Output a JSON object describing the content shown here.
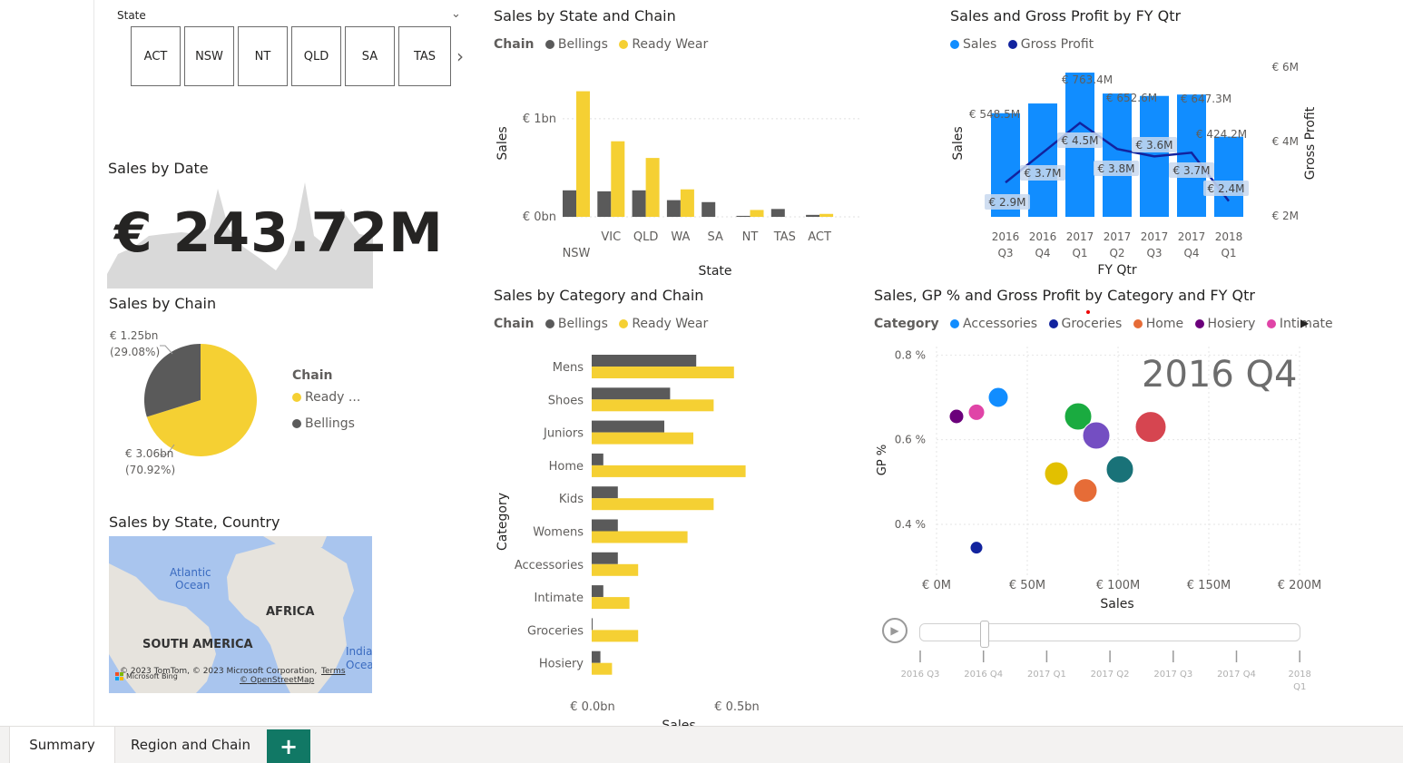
{
  "colors": {
    "bellings": "#5a5a5a",
    "ready_wear": "#f5d033",
    "sales_blue": "#118dff",
    "gp_navy": "#12239e",
    "page_bg": "#ffffff",
    "tab_accent": "#117865"
  },
  "slicer": {
    "label": "State",
    "tiles": [
      "ACT",
      "NSW",
      "NT",
      "QLD",
      "SA",
      "TAS"
    ]
  },
  "kpi": {
    "title": "Sales by Date",
    "value": "€ 243.72M"
  },
  "pie": {
    "title": "Sales by Chain",
    "legend_title": "Chain",
    "legend": [
      "Ready ...",
      "Bellings"
    ],
    "label_small_value": "€ 1.25bn",
    "label_small_pct": "(29.08%)",
    "label_large_value": "€ 3.06bn",
    "label_large_pct": "(70.92%)"
  },
  "map": {
    "title": "Sales by State, Country",
    "labels": {
      "atlantic": "Atlantic",
      "ocean": "Ocean",
      "africa": "AFRICA",
      "south_america": "SOUTH AMERICA",
      "india": "India",
      "ocea": "Ocea"
    },
    "attribution": "© 2023 TomTom, © 2023 Microsoft Corporation,",
    "terms": "Terms",
    "osm": "© OpenStreetMap",
    "bing": "Microsoft Bing"
  },
  "state_chart": {
    "title": "Sales by State and Chain",
    "legend_title": "Chain",
    "legend": [
      "Bellings",
      "Ready Wear"
    ],
    "ylabel": "Sales",
    "xlabel": "State",
    "ytick_top": "€ 1bn",
    "ytick_zero": "€ 0bn"
  },
  "category_chart": {
    "title": "Sales by Category and Chain",
    "legend_title": "Chain",
    "legend": [
      "Bellings",
      "Ready Wear"
    ],
    "ylabel": "Category",
    "xlabel": "Sales",
    "xtick_zero": "€ 0.0bn",
    "xtick_half": "€ 0.5bn"
  },
  "fy_chart": {
    "title": "Sales and Gross Profit by FY Qtr",
    "legend": [
      "Sales",
      "Gross Profit"
    ],
    "ylabel_left": "Sales",
    "ylabel_right": "Gross Profit",
    "xlabel": "FY Qtr",
    "right_ticks": [
      "€ 6M",
      "€ 4M",
      "€ 2M"
    ]
  },
  "scatter_chart": {
    "title": "Sales, GP % and Gross Profit by Category and FY Qtr",
    "legend_title": "Category",
    "legend": [
      "Accessories",
      "Groceries",
      "Home",
      "Hosiery",
      "Intimate"
    ],
    "play_value": "2016 Q4",
    "ylabel": "GP %",
    "xlabel": "Sales",
    "yticks": [
      "0.8 %",
      "0.6 %",
      "0.4 %"
    ],
    "xticks": [
      "€ 0M",
      "€ 50M",
      "€ 100M",
      "€ 150M",
      "€ 200M"
    ],
    "timeline": [
      "2016 Q3",
      "2016 Q4",
      "2017 Q1",
      "2017 Q2",
      "2017 Q3",
      "2017 Q4",
      "2018 Q1"
    ]
  },
  "tabs": {
    "summary": "Summary",
    "region": "Region and Chain",
    "add": "+"
  },
  "chart_data": [
    {
      "type": "bar",
      "title": "Sales by State and Chain",
      "xlabel": "State",
      "ylabel": "Sales",
      "categories": [
        "NSW",
        "VIC",
        "QLD",
        "WA",
        "SA",
        "NT",
        "TAS",
        "ACT"
      ],
      "series": [
        {
          "name": "Bellings",
          "values": [
            0.27,
            0.26,
            0.27,
            0.17,
            0.15,
            0.01,
            0.08,
            0.02
          ]
        },
        {
          "name": "Ready Wear",
          "values": [
            1.28,
            0.77,
            0.6,
            0.28,
            0.0,
            0.07,
            0.0,
            0.03
          ]
        }
      ],
      "ylim": [
        0,
        1.35
      ]
    },
    {
      "type": "bar",
      "orientation": "horizontal",
      "title": "Sales by Category and Chain",
      "xlabel": "Sales",
      "ylabel": "Category",
      "categories": [
        "Mens",
        "Shoes",
        "Juniors",
        "Home",
        "Kids",
        "Womens",
        "Accessories",
        "Intimate",
        "Groceries",
        "Hosiery"
      ],
      "series": [
        {
          "name": "Bellings",
          "values": [
            0.36,
            0.27,
            0.25,
            0.04,
            0.09,
            0.09,
            0.09,
            0.04,
            0.0,
            0.03
          ]
        },
        {
          "name": "Ready Wear",
          "values": [
            0.49,
            0.42,
            0.35,
            0.53,
            0.42,
            0.33,
            0.16,
            0.13,
            0.16,
            0.07
          ]
        }
      ],
      "xlim": [
        0,
        0.6
      ]
    },
    {
      "type": "bar",
      "title": "Sales and Gross Profit by FY Qtr",
      "xlabel": "FY Qtr",
      "categories": [
        "2016 Q3",
        "2016 Q4",
        "2017 Q1",
        "2017 Q2",
        "2017 Q3",
        "2017 Q4",
        "2018 Q1"
      ],
      "series": [
        {
          "name": "Sales",
          "values": [
            548.5,
            600.0,
            763.4,
            652.6,
            640.0,
            647.3,
            424.2
          ],
          "labels": [
            "€ 548.5M",
            "",
            "€ 763.4M",
            "€ 652.6M",
            "",
            "€ 647.3M",
            "€ 424.2M"
          ]
        },
        {
          "name": "Gross Profit",
          "type": "line",
          "values": [
            2.9,
            3.7,
            4.5,
            3.8,
            3.6,
            3.7,
            2.4
          ],
          "labels": [
            "€ 2.9M",
            "€ 3.7M",
            "€ 4.5M",
            "€ 3.8M",
            "€ 3.6M",
            "€ 3.7M",
            "€ 2.4M"
          ]
        }
      ],
      "ylim": [
        0,
        850
      ],
      "y2lim": [
        1.5,
        6.5
      ]
    },
    {
      "type": "scatter",
      "title": "Sales, GP % and Gross Profit by Category and FY Qtr",
      "xlabel": "Sales",
      "ylabel": "GP %",
      "xlim": [
        0,
        200
      ],
      "ylim": [
        0.28,
        0.82
      ],
      "points": [
        {
          "x": 34,
          "y": 0.7,
          "size": 11,
          "color": "#118dff"
        },
        {
          "x": 11,
          "y": 0.655,
          "size": 8,
          "color": "#6b007b"
        },
        {
          "x": 22,
          "y": 0.665,
          "size": 9,
          "color": "#e044a7"
        },
        {
          "x": 78,
          "y": 0.655,
          "size": 15,
          "color": "#1aab40"
        },
        {
          "x": 88,
          "y": 0.61,
          "size": 15,
          "color": "#744ec2"
        },
        {
          "x": 118,
          "y": 0.63,
          "size": 17,
          "color": "#d64550"
        },
        {
          "x": 66,
          "y": 0.52,
          "size": 13,
          "color": "#e2c000"
        },
        {
          "x": 101,
          "y": 0.53,
          "size": 15,
          "color": "#197278"
        },
        {
          "x": 82,
          "y": 0.48,
          "size": 13,
          "color": "#e66c37"
        },
        {
          "x": 22,
          "y": 0.345,
          "size": 7,
          "color": "#12239e"
        }
      ]
    }
  ]
}
